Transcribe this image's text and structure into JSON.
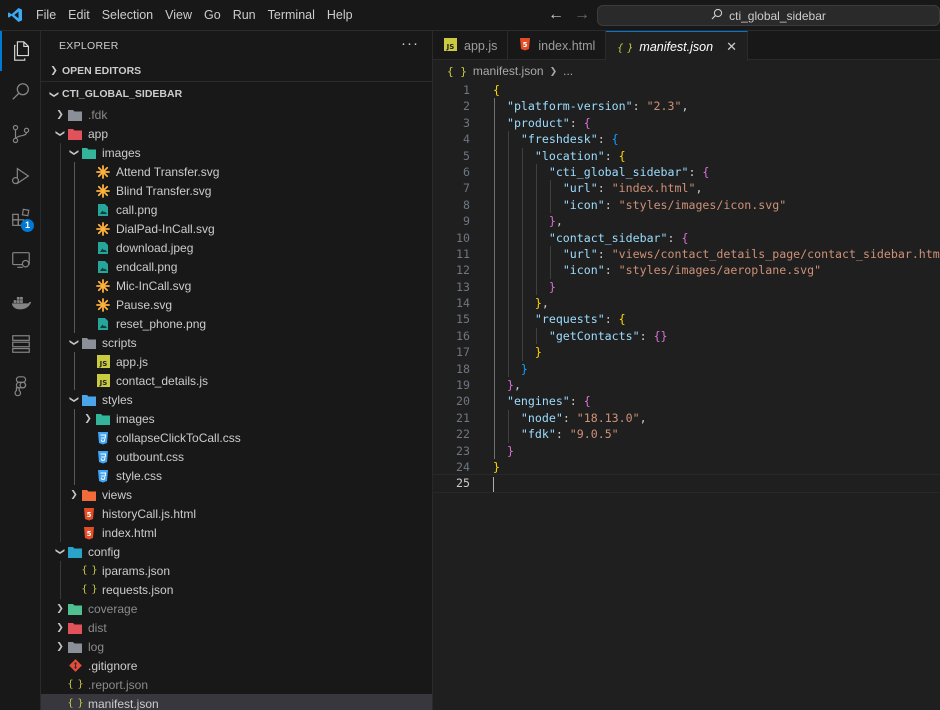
{
  "titlebar": {
    "menu": [
      "File",
      "Edit",
      "Selection",
      "View",
      "Go",
      "Run",
      "Terminal",
      "Help"
    ],
    "search_text": "cti_global_sidebar",
    "colors": {
      "logo": "#3ca9f2"
    }
  },
  "activitybar": {
    "icons": [
      "explorer-icon",
      "search-icon",
      "source-control-icon",
      "run-debug-icon",
      "extensions-icon",
      "remote-explorer-icon",
      "docker-icon",
      "database-icon",
      "figma-icon"
    ],
    "extensions_badge": "1"
  },
  "sidebar": {
    "title": "EXPLORER",
    "more": "···",
    "open_editors": "OPEN EDITORS",
    "project": "CTI_GLOBAL_SIDEBAR",
    "tree": [
      {
        "label": ".fdk",
        "depth": 0,
        "type": "folder",
        "expanded": false,
        "dim": true,
        "icon": "folder-gray"
      },
      {
        "label": "app",
        "depth": 0,
        "type": "folder",
        "expanded": true,
        "icon": "folder-red"
      },
      {
        "label": "images",
        "depth": 1,
        "type": "folder",
        "expanded": true,
        "icon": "folder-teal"
      },
      {
        "label": "Attend Transfer.svg",
        "depth": 2,
        "type": "file",
        "icon": "svg"
      },
      {
        "label": "Blind Transfer.svg",
        "depth": 2,
        "type": "file",
        "icon": "svg"
      },
      {
        "label": "call.png",
        "depth": 2,
        "type": "file",
        "icon": "image"
      },
      {
        "label": "DialPad-InCall.svg",
        "depth": 2,
        "type": "file",
        "icon": "svg"
      },
      {
        "label": "download.jpeg",
        "depth": 2,
        "type": "file",
        "icon": "image"
      },
      {
        "label": "endcall.png",
        "depth": 2,
        "type": "file",
        "icon": "image"
      },
      {
        "label": "Mic-InCall.svg",
        "depth": 2,
        "type": "file",
        "icon": "svg"
      },
      {
        "label": "Pause.svg",
        "depth": 2,
        "type": "file",
        "icon": "svg"
      },
      {
        "label": "reset_phone.png",
        "depth": 2,
        "type": "file",
        "icon": "image"
      },
      {
        "label": "scripts",
        "depth": 1,
        "type": "folder",
        "expanded": true,
        "icon": "folder-gray"
      },
      {
        "label": "app.js",
        "depth": 2,
        "type": "file",
        "icon": "js"
      },
      {
        "label": "contact_details.js",
        "depth": 2,
        "type": "file",
        "icon": "js"
      },
      {
        "label": "styles",
        "depth": 1,
        "type": "folder",
        "expanded": true,
        "icon": "folder-blue"
      },
      {
        "label": "images",
        "depth": 2,
        "type": "folder",
        "expanded": false,
        "icon": "folder-teal"
      },
      {
        "label": "collapseClickToCall.css",
        "depth": 2,
        "type": "file",
        "icon": "css"
      },
      {
        "label": "outbount.css",
        "depth": 2,
        "type": "file",
        "icon": "css"
      },
      {
        "label": "style.css",
        "depth": 2,
        "type": "file",
        "icon": "css"
      },
      {
        "label": "views",
        "depth": 1,
        "type": "folder",
        "expanded": false,
        "icon": "folder-orange"
      },
      {
        "label": "historyCall.js.html",
        "depth": 1,
        "type": "file",
        "icon": "html"
      },
      {
        "label": "index.html",
        "depth": 1,
        "type": "file",
        "icon": "html"
      },
      {
        "label": "config",
        "depth": 0,
        "type": "folder",
        "expanded": true,
        "icon": "folder-config"
      },
      {
        "label": "iparams.json",
        "depth": 1,
        "type": "file",
        "icon": "json"
      },
      {
        "label": "requests.json",
        "depth": 1,
        "type": "file",
        "icon": "json"
      },
      {
        "label": "coverage",
        "depth": 0,
        "type": "folder",
        "expanded": false,
        "dim": true,
        "icon": "folder-green"
      },
      {
        "label": "dist",
        "depth": 0,
        "type": "folder",
        "expanded": false,
        "dim": true,
        "icon": "folder-red"
      },
      {
        "label": "log",
        "depth": 0,
        "type": "folder",
        "expanded": false,
        "dim": true,
        "icon": "folder-gray"
      },
      {
        "label": ".gitignore",
        "depth": 0,
        "type": "file",
        "icon": "git"
      },
      {
        "label": ".report.json",
        "depth": 0,
        "type": "file",
        "dim": true,
        "icon": "json"
      },
      {
        "label": "manifest.json",
        "depth": 0,
        "type": "file",
        "selected": true,
        "icon": "json"
      }
    ]
  },
  "editor": {
    "tabs": [
      {
        "label": "app.js",
        "icon": "js",
        "active": false
      },
      {
        "label": "index.html",
        "icon": "html",
        "active": false
      },
      {
        "label": "manifest.json",
        "icon": "json",
        "active": true
      }
    ],
    "breadcrumb": [
      "manifest.json",
      "..."
    ],
    "current_line": 25,
    "lines": [
      [
        [
          "{",
          "b1"
        ]
      ],
      [
        [
          "  ",
          ""
        ],
        [
          "\"platform-version\"",
          "k"
        ],
        [
          ": ",
          "p"
        ],
        [
          "\"2.3\"",
          "s"
        ],
        [
          ",",
          "p"
        ]
      ],
      [
        [
          "  ",
          ""
        ],
        [
          "\"product\"",
          "k"
        ],
        [
          ": ",
          "p"
        ],
        [
          "{",
          "b2"
        ]
      ],
      [
        [
          "    ",
          ""
        ],
        [
          "\"freshdesk\"",
          "k"
        ],
        [
          ": ",
          "p"
        ],
        [
          "{",
          "b3"
        ]
      ],
      [
        [
          "      ",
          ""
        ],
        [
          "\"location\"",
          "k"
        ],
        [
          ": ",
          "p"
        ],
        [
          "{",
          "b1"
        ]
      ],
      [
        [
          "        ",
          ""
        ],
        [
          "\"cti_global_sidebar\"",
          "k"
        ],
        [
          ": ",
          "p"
        ],
        [
          "{",
          "b2"
        ]
      ],
      [
        [
          "          ",
          ""
        ],
        [
          "\"url\"",
          "k"
        ],
        [
          ": ",
          "p"
        ],
        [
          "\"index.html\"",
          "s"
        ],
        [
          ",",
          "p"
        ]
      ],
      [
        [
          "          ",
          ""
        ],
        [
          "\"icon\"",
          "k"
        ],
        [
          ": ",
          "p"
        ],
        [
          "\"styles/images/icon.svg\"",
          "s"
        ]
      ],
      [
        [
          "        ",
          ""
        ],
        [
          "}",
          "b2"
        ],
        [
          ",",
          "p"
        ]
      ],
      [
        [
          "        ",
          ""
        ],
        [
          "\"contact_sidebar\"",
          "k"
        ],
        [
          ": ",
          "p"
        ],
        [
          "{",
          "b2"
        ]
      ],
      [
        [
          "          ",
          ""
        ],
        [
          "\"url\"",
          "k"
        ],
        [
          ": ",
          "p"
        ],
        [
          "\"views/contact_details_page/contact_sidebar.html\"",
          "s"
        ],
        [
          ",",
          "p"
        ]
      ],
      [
        [
          "          ",
          ""
        ],
        [
          "\"icon\"",
          "k"
        ],
        [
          ": ",
          "p"
        ],
        [
          "\"styles/images/aeroplane.svg\"",
          "s"
        ]
      ],
      [
        [
          "        ",
          ""
        ],
        [
          "}",
          "b2"
        ]
      ],
      [
        [
          "      ",
          ""
        ],
        [
          "}",
          "b1"
        ],
        [
          ",",
          "p"
        ]
      ],
      [
        [
          "      ",
          ""
        ],
        [
          "\"requests\"",
          "k"
        ],
        [
          ": ",
          "p"
        ],
        [
          "{",
          "b1"
        ]
      ],
      [
        [
          "        ",
          ""
        ],
        [
          "\"getContacts\"",
          "k"
        ],
        [
          ": ",
          "p"
        ],
        [
          "{}",
          "b2"
        ]
      ],
      [
        [
          "      ",
          ""
        ],
        [
          "}",
          "b1"
        ]
      ],
      [
        [
          "    ",
          ""
        ],
        [
          "}",
          "b3"
        ]
      ],
      [
        [
          "  ",
          ""
        ],
        [
          "}",
          "b2"
        ],
        [
          ",",
          "p"
        ]
      ],
      [
        [
          "  ",
          ""
        ],
        [
          "\"engines\"",
          "k"
        ],
        [
          ": ",
          "p"
        ],
        [
          "{",
          "b2"
        ]
      ],
      [
        [
          "    ",
          ""
        ],
        [
          "\"node\"",
          "k"
        ],
        [
          ": ",
          "p"
        ],
        [
          "\"18.13.0\"",
          "s"
        ],
        [
          ",",
          "p"
        ]
      ],
      [
        [
          "    ",
          ""
        ],
        [
          "\"fdk\"",
          "k"
        ],
        [
          ": ",
          "p"
        ],
        [
          "\"9.0.5\"",
          "s"
        ]
      ],
      [
        [
          "  ",
          ""
        ],
        [
          "}",
          "b2"
        ]
      ],
      [
        [
          "}",
          "b1"
        ]
      ],
      [
        [
          "",
          ""
        ]
      ]
    ]
  }
}
